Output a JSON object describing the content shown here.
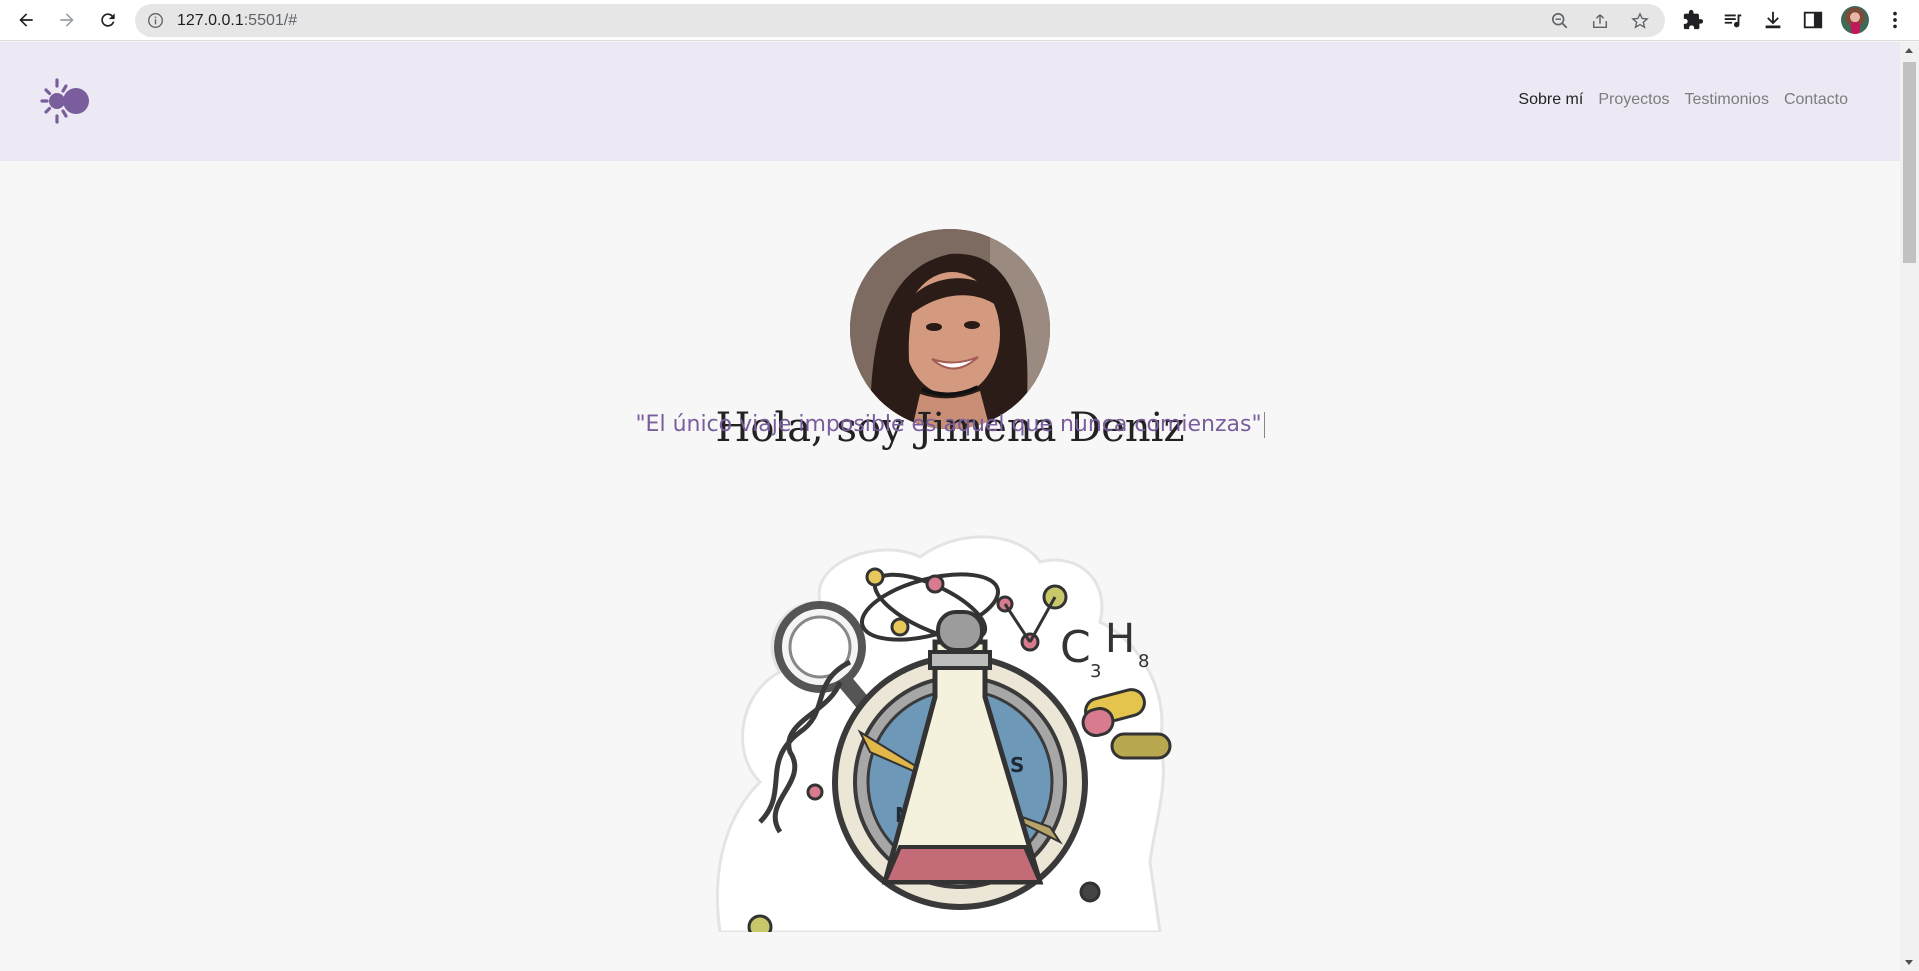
{
  "browser": {
    "url_host": "127.0.0.1",
    "url_rest": ":5501/#"
  },
  "nav": {
    "items": [
      {
        "label": "Sobre mí",
        "active": true
      },
      {
        "label": "Proyectos",
        "active": false
      },
      {
        "label": "Testimonios",
        "active": false
      },
      {
        "label": "Contacto",
        "active": false
      }
    ]
  },
  "hero": {
    "title": "Hola, soy Jimena Deniz",
    "quote": "\"El único viaje imposible es aquel que nunca comienzas\""
  },
  "illustration": {
    "formula_main": "C",
    "formula_sub1": "3",
    "formula_h": "H",
    "formula_sub2": "8",
    "compass_letters": [
      "N",
      "S",
      "N"
    ]
  },
  "colors": {
    "accent": "#7a5d9c",
    "header_bg": "#ece9f5",
    "page_bg": "#f7f7f7"
  }
}
